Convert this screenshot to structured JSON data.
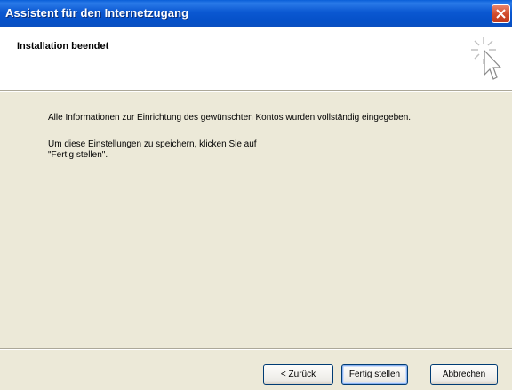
{
  "window": {
    "title": "Assistent für den Internetzugang"
  },
  "header": {
    "title": "Installation beendet",
    "icon": "wizard-icon"
  },
  "content": {
    "paragraph1": "Alle Informationen zur Einrichtung des gewünschten Kontos wurden vollständig eingegeben.",
    "paragraph2_line1": "Um diese Einstellungen zu speichern, klicken Sie auf",
    "paragraph2_line2": "\"Fertig stellen\"."
  },
  "buttons": {
    "back": "< Zurück",
    "finish": "Fertig stellen",
    "cancel": "Abbrechen"
  },
  "colors": {
    "titlebar": "#0550c8",
    "dialog_bg": "#ece9d8",
    "close_button": "#d04a2a"
  }
}
